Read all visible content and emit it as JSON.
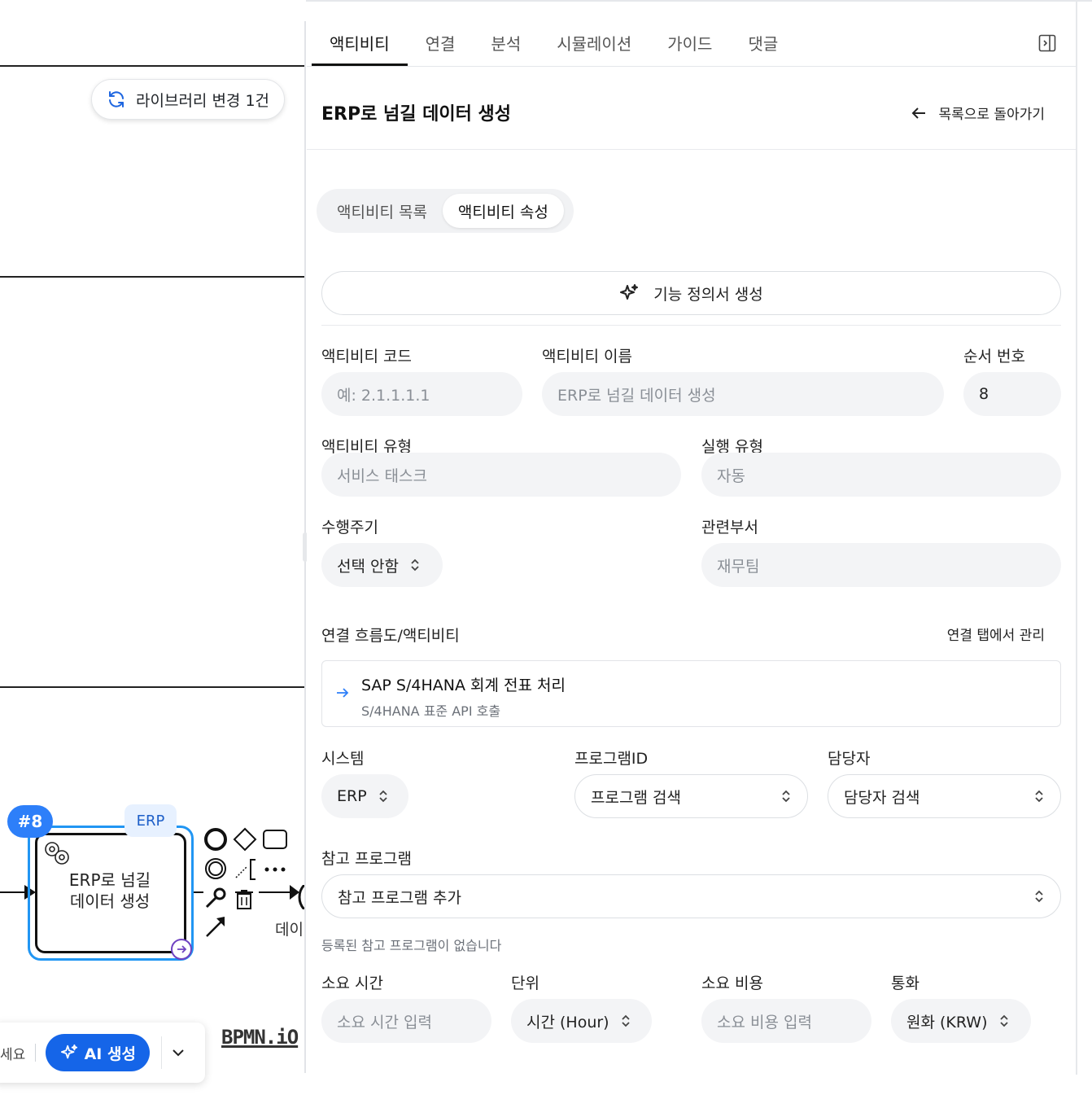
{
  "canvas": {
    "library_badge": "라이브러리 변경 1건",
    "task": {
      "number": "#8",
      "system_tag": "ERP",
      "label_line1": "ERP로 넘길",
      "label_line2": "데이터 생성"
    },
    "partial_label": "데이",
    "bpmn_logo": "BPMN.iO",
    "ai_bar": {
      "cut_text": "세요",
      "ai_button": "AI 생성"
    }
  },
  "tabs": [
    "액티비티",
    "연결",
    "분석",
    "시뮬레이션",
    "가이드",
    "댓글"
  ],
  "active_tab": "액티비티",
  "header": {
    "title": "ERP로 넘길 데이터 생성",
    "back_link": "목록으로 돌아가기"
  },
  "segment": {
    "items": [
      "액티비티 목록",
      "액티비티 속성"
    ],
    "active": "액티비티 속성"
  },
  "generate_button": "기능 정의서 생성",
  "form": {
    "activity_code": {
      "label": "액티비티 코드",
      "placeholder": "예: 2.1.1.1.1"
    },
    "activity_name": {
      "label": "액티비티 이름",
      "placeholder": "ERP로 넘길 데이터 생성"
    },
    "order_number": {
      "label": "순서 번호",
      "value": "8"
    },
    "activity_type": {
      "label": "액티비티 유형",
      "value": "서비스 태스크"
    },
    "execution_type": {
      "label": "실행 유형",
      "value": "자동"
    },
    "cycle": {
      "label": "수행주기",
      "value": "선택 안함"
    },
    "department": {
      "label": "관련부서",
      "value": "재무팀"
    },
    "linked": {
      "label": "연결 흐름도/액티비티",
      "manage_link": "연결 탭에서 관리",
      "items": [
        {
          "title": "SAP S/4HANA 회계 전표 처리",
          "subtitle": "S/4HANA 표준 API 호출"
        }
      ]
    },
    "system": {
      "label": "시스템",
      "value": "ERP"
    },
    "program_id": {
      "label": "프로그램ID",
      "value": "프로그램 검색"
    },
    "owner": {
      "label": "담당자",
      "value": "담당자 검색"
    },
    "ref_program": {
      "label": "참고 프로그램",
      "value": "참고 프로그램 추가",
      "empty_hint": "등록된 참고 프로그램이 없습니다"
    },
    "duration": {
      "label": "소요 시간",
      "placeholder": "소요 시간 입력"
    },
    "unit": {
      "label": "단위",
      "value": "시간 (Hour)"
    },
    "cost": {
      "label": "소요 비용",
      "placeholder": "소요 비용 입력"
    },
    "currency": {
      "label": "통화",
      "value": "원화 (KRW)"
    }
  },
  "colors": {
    "accent_blue": "#1565e8",
    "task_selection": "#2196f3",
    "badge_blue": "#2d7ff9",
    "field_bg": "#f3f4f6"
  }
}
